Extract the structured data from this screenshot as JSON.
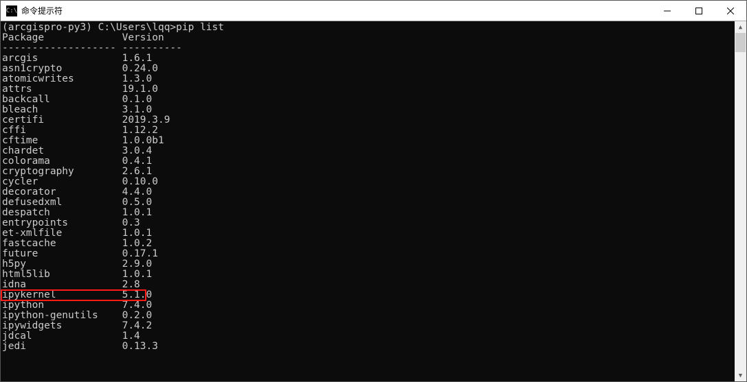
{
  "window": {
    "title": "命令提示符",
    "icon_label": "C:\\"
  },
  "prompt": {
    "env": "(arcgispro-py3)",
    "path": "C:\\Users\\lqq>",
    "command": "pip list"
  },
  "header": {
    "col1": "Package",
    "col2": "Version",
    "sep1": "-------------------",
    "sep2": "----------"
  },
  "packages": [
    {
      "name": "arcgis",
      "version": "1.6.1"
    },
    {
      "name": "asn1crypto",
      "version": "0.24.0"
    },
    {
      "name": "atomicwrites",
      "version": "1.3.0"
    },
    {
      "name": "attrs",
      "version": "19.1.0"
    },
    {
      "name": "backcall",
      "version": "0.1.0"
    },
    {
      "name": "bleach",
      "version": "3.1.0"
    },
    {
      "name": "certifi",
      "version": "2019.3.9"
    },
    {
      "name": "cffi",
      "version": "1.12.2"
    },
    {
      "name": "cftime",
      "version": "1.0.0b1"
    },
    {
      "name": "chardet",
      "version": "3.0.4"
    },
    {
      "name": "colorama",
      "version": "0.4.1"
    },
    {
      "name": "cryptography",
      "version": "2.6.1"
    },
    {
      "name": "cycler",
      "version": "0.10.0"
    },
    {
      "name": "decorator",
      "version": "4.4.0"
    },
    {
      "name": "defusedxml",
      "version": "0.5.0"
    },
    {
      "name": "despatch",
      "version": "1.0.1"
    },
    {
      "name": "entrypoints",
      "version": "0.3"
    },
    {
      "name": "et-xmlfile",
      "version": "1.0.1"
    },
    {
      "name": "fastcache",
      "version": "1.0.2"
    },
    {
      "name": "future",
      "version": "0.17.1"
    },
    {
      "name": "h5py",
      "version": "2.9.0"
    },
    {
      "name": "html5lib",
      "version": "1.0.1"
    },
    {
      "name": "idna",
      "version": "2.8"
    },
    {
      "name": "ipykernel",
      "version": "5.1.0"
    },
    {
      "name": "ipython",
      "version": "7.4.0"
    },
    {
      "name": "ipython-genutils",
      "version": "0.2.0"
    },
    {
      "name": "ipywidgets",
      "version": "7.4.2"
    },
    {
      "name": "jdcal",
      "version": "1.4"
    },
    {
      "name": "jedi",
      "version": "0.13.3"
    }
  ],
  "highlight_index": 23,
  "column_pad": 20
}
